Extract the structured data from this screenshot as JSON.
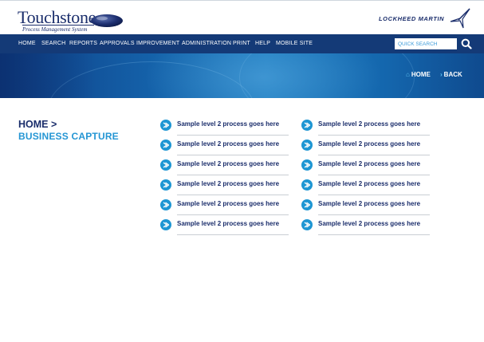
{
  "brand": {
    "name": "Touchstone",
    "subtitle": "Process Management System",
    "partner": "LOCKHEED MARTIN"
  },
  "nav": {
    "items": [
      "HOME",
      "SEARCH",
      "REPORTS",
      "APPROVALS",
      "IMPROVEMENT",
      "ADMINISTRATION",
      "PRINT",
      "HELP",
      "MOBILE SITE"
    ],
    "search_placeholder": "QUICK SEARCH"
  },
  "banner": {
    "home_label": "HOME",
    "back_label": "BACK"
  },
  "breadcrumb": {
    "home": "HOME >",
    "current": "BUSINESS CAPTURE"
  },
  "processes": {
    "left": [
      "Sample level 2 process goes here",
      "Sample level 2 process goes here",
      "Sample level 2 process goes here",
      "Sample level 2 process goes here",
      "Sample level 2 process goes here",
      "Sample level 2 process goes here"
    ],
    "right": [
      "Sample level 2 process goes here",
      "Sample level 2 process goes here",
      "Sample level 2 process goes here",
      "Sample level 2 process goes here",
      "Sample level 2 process goes here",
      "Sample level 2 process goes here"
    ]
  },
  "colors": {
    "navy": "#1a2d6b",
    "nav_bar": "#143a77",
    "accent": "#2596d4"
  },
  "icons": {
    "search": "search-icon",
    "home": "home-icon",
    "back": "chevron-right-icon",
    "process": "chevron-right-circle-icon"
  }
}
